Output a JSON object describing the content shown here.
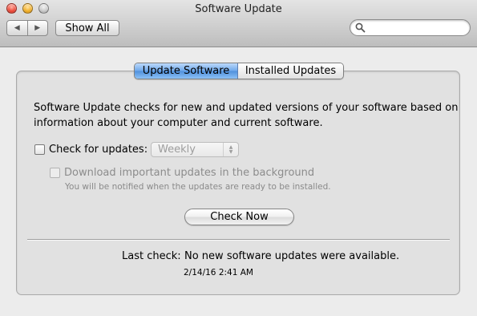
{
  "window": {
    "title": "Software Update",
    "controls": [
      "close",
      "minimize",
      "zoom"
    ]
  },
  "toolbar": {
    "back_icon": "back-arrow-icon",
    "forward_icon": "forward-arrow-icon",
    "show_all_label": "Show All",
    "search": {
      "value": "",
      "placeholder": "",
      "icon": "search-icon"
    }
  },
  "tabs": [
    {
      "label": "Update Software",
      "selected": true
    },
    {
      "label": "Installed Updates",
      "selected": false
    }
  ],
  "content": {
    "description": "Software Update checks for new and updated versions of your software based on information about your computer and current software.",
    "check_for_updates": {
      "label": "Check for updates:",
      "checked": false
    },
    "frequency": {
      "value": "Weekly",
      "enabled": false
    },
    "download_background": {
      "label": "Download important updates in the background",
      "checked": false,
      "enabled": false
    },
    "download_note": "You will be notified when the updates are ready to be installed.",
    "check_now_label": "Check Now",
    "last_check": {
      "label": "Last check:",
      "value": "No new software updates were available.",
      "timestamp": "2/14/16 2:41 AM"
    }
  },
  "colors": {
    "selected_tab": "#6ea8ea",
    "disabled_text": "#8c8c8c",
    "window_background": "#ececec"
  }
}
